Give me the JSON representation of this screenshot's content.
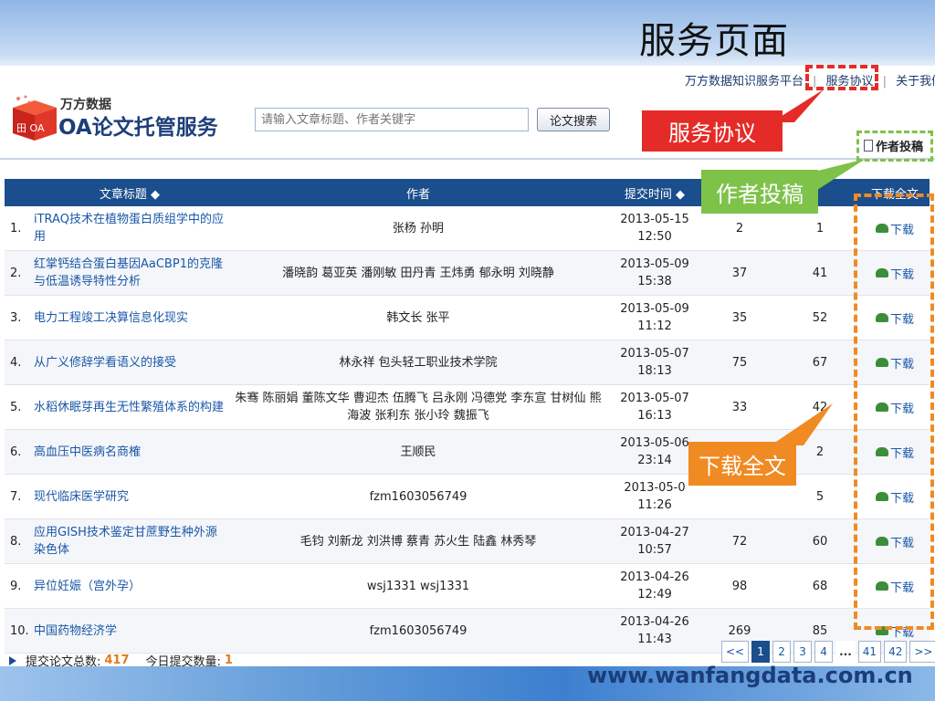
{
  "slide": {
    "title": "服务页面",
    "site_url": "www.wanfangdata.com.cn"
  },
  "top_links": [
    "万方数据知识服务平台",
    "服务协议",
    "关于我们"
  ],
  "logo": {
    "brand_small": "万方数据",
    "brand_big": "OA论文托管服务",
    "cube_text": "田 OA"
  },
  "search": {
    "placeholder": "请输入文章标题、作者关键字",
    "button_label": "论文搜索"
  },
  "author_submit_label": "作者投稿",
  "callouts": {
    "service_agreement": "服务协议",
    "author_submit": "作者投稿",
    "download_full": "下载全文"
  },
  "table": {
    "headers": [
      "文章标题 ◆",
      "作者",
      "提交时间 ◆",
      "",
      "",
      "下载全文"
    ],
    "rows": [
      {
        "idx": "1.",
        "title": "iTRAQ技术在植物蛋白质组学中的应用",
        "authors": "张杨 孙明",
        "date": "2013-05-15",
        "time": "12:50",
        "n1": "2",
        "n2": "1",
        "dl": "下载"
      },
      {
        "idx": "2.",
        "title": "红掌钙结合蛋白基因AaCBP1的克隆与低温诱导特性分析",
        "authors": "潘晓韵 葛亚英 潘刚敏 田丹青 王炜勇 郁永明 刘晓静",
        "date": "2013-05-09",
        "time": "15:38",
        "n1": "37",
        "n2": "41",
        "dl": "下载"
      },
      {
        "idx": "3.",
        "title": "电力工程竣工决算信息化现实",
        "authors": "韩文长 张平",
        "date": "2013-05-09",
        "time": "11:12",
        "n1": "35",
        "n2": "52",
        "dl": "下载"
      },
      {
        "idx": "4.",
        "title": "从广义修辞学看语义的接受",
        "authors": "林永祥 包头轻工职业技术学院",
        "date": "2013-05-07",
        "time": "18:13",
        "n1": "75",
        "n2": "67",
        "dl": "下载"
      },
      {
        "idx": "5.",
        "title": "水稻休眠芽再生无性繁殖体系的构建",
        "authors": "朱骞 陈丽娟 董陈文华 曹迎杰 伍腾飞 吕永刚 冯德党 李东宣 甘树仙 熊海波 张利东 张小玲 魏振飞",
        "date": "2013-05-07",
        "time": "16:13",
        "n1": "33",
        "n2": "42",
        "dl": "下载"
      },
      {
        "idx": "6.",
        "title": "高血压中医病名商榷",
        "authors": "王顺民",
        "date": "2013-05-06",
        "time": "23:14",
        "n1": "",
        "n2": "2",
        "dl": "下载"
      },
      {
        "idx": "7.",
        "title": "现代临床医学研究",
        "authors": "fzm1603056749",
        "date": "2013-05-0",
        "time": "11:26",
        "n1": "",
        "n2": "5",
        "dl": "下载"
      },
      {
        "idx": "8.",
        "title": "应用GISH技术鉴定甘蔗野生种外源染色体",
        "authors": "毛钧 刘新龙 刘洪博 蔡青 苏火生 陆鑫 林秀琴",
        "date": "2013-04-27",
        "time": "10:57",
        "n1": "72",
        "n2": "60",
        "dl": "下载"
      },
      {
        "idx": "9.",
        "title": "异位妊娠（宫外孕）",
        "authors": "wsj1331 wsj1331",
        "date": "2013-04-26",
        "time": "12:49",
        "n1": "98",
        "n2": "68",
        "dl": "下载"
      },
      {
        "idx": "10.",
        "title": "中国药物经济学",
        "authors": "fzm1603056749",
        "date": "2013-04-26",
        "time": "11:43",
        "n1": "269",
        "n2": "85",
        "dl": "下载"
      }
    ]
  },
  "footer": {
    "total_label": "提交论文总数:",
    "total_value": "417",
    "today_label": "今日提交数量:",
    "today_value": "1"
  },
  "pager": [
    "<<",
    "1",
    "2",
    "3",
    "4",
    "...",
    "41",
    "42",
    ">>"
  ],
  "pager_active": "1",
  "colors": {
    "header_blue": "#1b4e8c",
    "callout_red": "#e52b28",
    "callout_green": "#7ec24a",
    "callout_orange": "#f08a22"
  }
}
